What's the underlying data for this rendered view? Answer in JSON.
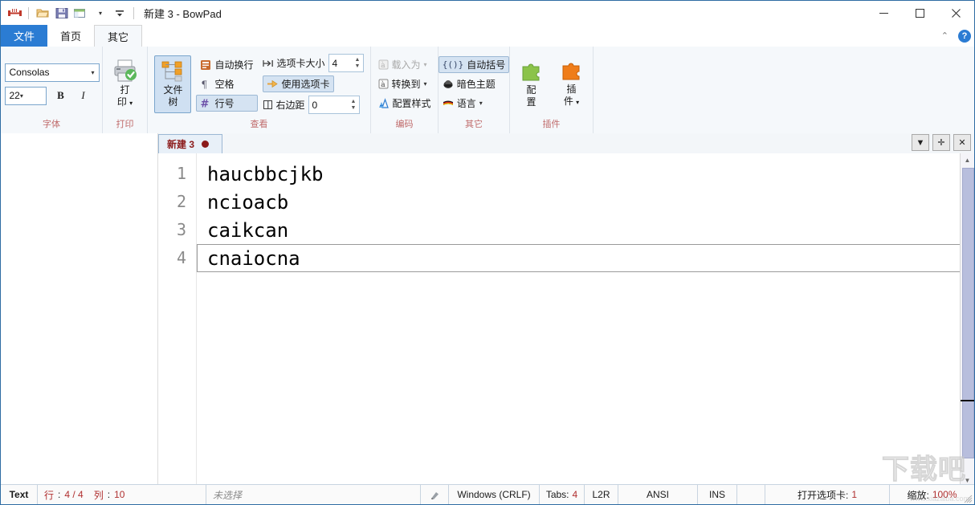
{
  "window": {
    "title": "新建 3 - BowPad",
    "quick_access": [
      {
        "name": "app-logo-icon",
        "glyph": "bowpad"
      },
      {
        "name": "open-file-icon",
        "glyph": "folder"
      },
      {
        "name": "save-icon",
        "glyph": "save"
      },
      {
        "name": "window-view-icon",
        "glyph": "window"
      },
      {
        "name": "qat-dropdown-icon",
        "glyph": "caret"
      }
    ],
    "controls": {
      "minimize": "—",
      "maximize": "▢",
      "close": "✕"
    }
  },
  "ribbon": {
    "tabs": [
      {
        "label": "文件",
        "kind": "file"
      },
      {
        "label": "首页",
        "kind": "normal"
      },
      {
        "label": "其它",
        "kind": "selected"
      }
    ],
    "collapse_label": "⌃",
    "help_label": "?",
    "groups": [
      {
        "name": "font",
        "label": "字体",
        "font_name": "Consolas",
        "font_size": "22",
        "bold_label": "B",
        "italic_label": "I"
      },
      {
        "name": "print",
        "label": "打印",
        "print_label": "打\n印",
        "print_dropdown": "▾"
      },
      {
        "name": "view",
        "label": "查看",
        "filetree_label": "文件\n树",
        "items": [
          {
            "label": "自动换行",
            "active": false,
            "icon": "wordwrap-icon"
          },
          {
            "label": "空格",
            "active": false,
            "icon": "whitespace-icon"
          },
          {
            "label": "行号",
            "active": true,
            "icon": "linenumbers-icon"
          }
        ],
        "tabsize_label": "选项卡大小",
        "tabsize_value": "4",
        "usetabs_label": "使用选项卡",
        "usetabs_active": true,
        "margin_label": "右边距",
        "margin_value": "0"
      },
      {
        "name": "encoding",
        "label": "编码",
        "items": [
          {
            "label": "载入为",
            "disabled": true,
            "dropdown": true,
            "icon": "load-as-icon"
          },
          {
            "label": "转换到",
            "disabled": false,
            "dropdown": true,
            "icon": "convert-to-icon"
          },
          {
            "label": "配置样式",
            "disabled": false,
            "dropdown": false,
            "icon": "style-config-icon"
          }
        ]
      },
      {
        "name": "other",
        "label": "其它",
        "items": [
          {
            "label": "自动括号",
            "active": true,
            "dropdown": false,
            "icon": "auto-brackets-icon"
          },
          {
            "label": "暗色主题",
            "active": false,
            "dropdown": false,
            "icon": "dark-theme-icon"
          },
          {
            "label": "语言",
            "active": false,
            "dropdown": true,
            "icon": "language-icon"
          }
        ]
      },
      {
        "name": "plugins",
        "label": "插件",
        "config_label": "配\n置",
        "plugin_label": "插\n件",
        "plugin_dropdown": "▾"
      }
    ]
  },
  "editor": {
    "tab": {
      "name": "新建 3",
      "modified": true
    },
    "tab_buttons": [
      {
        "name": "tab-list-button",
        "glyph": "▼"
      },
      {
        "name": "new-tab-button",
        "glyph": "✛"
      },
      {
        "name": "close-tab-button",
        "glyph": "✕"
      }
    ],
    "lines": [
      {
        "number": "1",
        "text": "haucbbcjkb",
        "current": false
      },
      {
        "number": "2",
        "text": "ncioacb",
        "current": false
      },
      {
        "number": "3",
        "text": "caikcan",
        "current": false
      },
      {
        "number": "4",
        "text": "cnaiocna",
        "current": true
      }
    ]
  },
  "statusbar": {
    "doctype": "Text",
    "position_prefix": "行",
    "position_value": "4 / 4",
    "column_prefix": "列",
    "column_value": "10",
    "selection": "未选择",
    "eol": "Windows (CRLF)",
    "tabs_prefix": "Tabs:",
    "tabs_value": "4",
    "direction": "L2R",
    "encoding": "ANSI",
    "insert_mode": "INS",
    "open_tabs_prefix": "打开选项卡:",
    "open_tabs_value": "1",
    "zoom_prefix": "缩放:",
    "zoom_value": "100%"
  },
  "watermark": {
    "big": "下载吧",
    "small": "www.xiazaiba.com"
  },
  "colors": {
    "accent": "#2b7cd3",
    "group_label": "#c06b6b",
    "tab_text": "#8b1a1a",
    "status_red": "#b03030"
  }
}
